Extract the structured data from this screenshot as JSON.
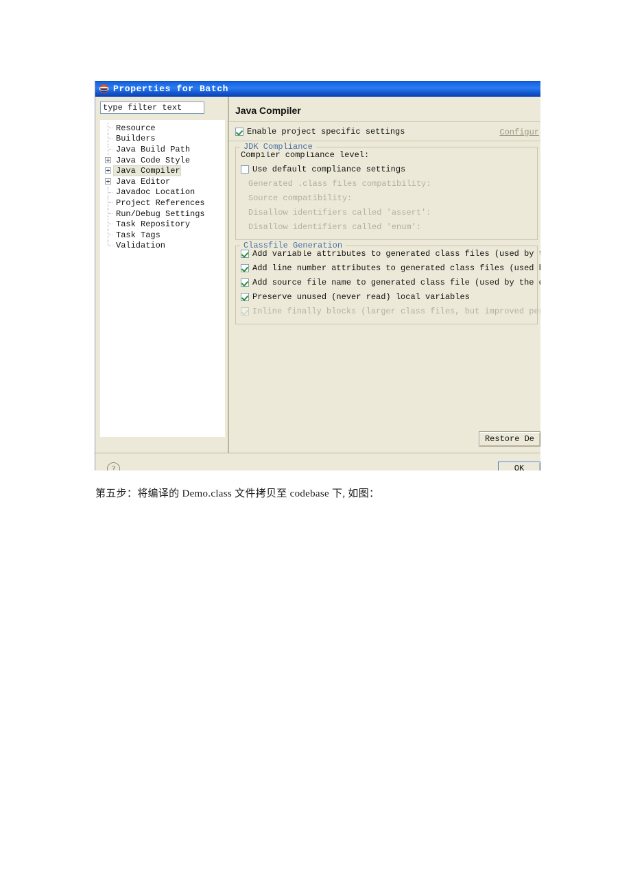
{
  "dialog": {
    "title": "Properties for Batch",
    "title_icon": "eclipse-globe-icon",
    "filter": {
      "value": "type filter text",
      "placeholder": "type filter text"
    },
    "tree": {
      "items": [
        {
          "label": "Resource",
          "expandable": false,
          "selected": false
        },
        {
          "label": "Builders",
          "expandable": false,
          "selected": false
        },
        {
          "label": "Java Build Path",
          "expandable": false,
          "selected": false
        },
        {
          "label": "Java Code Style",
          "expandable": true,
          "selected": false
        },
        {
          "label": "Java Compiler",
          "expandable": true,
          "selected": true
        },
        {
          "label": "Java Editor",
          "expandable": true,
          "selected": false
        },
        {
          "label": "Javadoc Location",
          "expandable": false,
          "selected": false
        },
        {
          "label": "Project References",
          "expandable": false,
          "selected": false
        },
        {
          "label": "Run/Debug Settings",
          "expandable": false,
          "selected": false
        },
        {
          "label": "Task Repository",
          "expandable": false,
          "selected": false
        },
        {
          "label": "Task Tags",
          "expandable": false,
          "selected": false
        },
        {
          "label": "Validation",
          "expandable": false,
          "selected": false
        }
      ]
    },
    "page": {
      "title": "Java Compiler",
      "enable_project_specific": {
        "label": "Enable project specific settings",
        "checked": true
      },
      "configure_link": "Configur",
      "jdk_compliance": {
        "legend": "JDK Compliance",
        "compliance_level_label": "Compiler compliance level:",
        "use_default": {
          "label": "Use default compliance settings",
          "checked": false
        },
        "disabled_rows": [
          "Generated .class files compatibility:",
          "Source compatibility:",
          "Disallow identifiers called 'assert':",
          "Disallow identifiers called 'enum':"
        ]
      },
      "classfile_generation": {
        "legend": "Classfile Generation",
        "options": [
          {
            "label": "Add variable attributes to generated class files (used by the debu",
            "checked": true,
            "disabled": false
          },
          {
            "label": "Add line number attributes to generated class files (used by the ",
            "checked": true,
            "disabled": false
          },
          {
            "label": "Add source file name to generated class file (used by the debugger",
            "checked": true,
            "disabled": false
          },
          {
            "label": "Preserve unused (never read) local variables",
            "checked": true,
            "disabled": false
          },
          {
            "label": "Inline finally blocks (larger class files, but improved performanc",
            "checked": true,
            "disabled": true
          }
        ]
      },
      "restore_defaults_label": "Restore De"
    },
    "footer": {
      "help_icon": "question-mark-icon",
      "help_glyph": "?",
      "ok_label": "OK"
    }
  },
  "caption": "第五步：将编译的 Demo.class 文件拷贝至 codebase 下, 如图：",
  "colors": {
    "titlebar_blue": "#1a66e0",
    "dialog_bg": "#ece9d8",
    "group_legend": "#4a6fa5",
    "check_green": "#29922b",
    "disabled_text": "#b3b0a0",
    "tree_bg": "#ffffff"
  }
}
